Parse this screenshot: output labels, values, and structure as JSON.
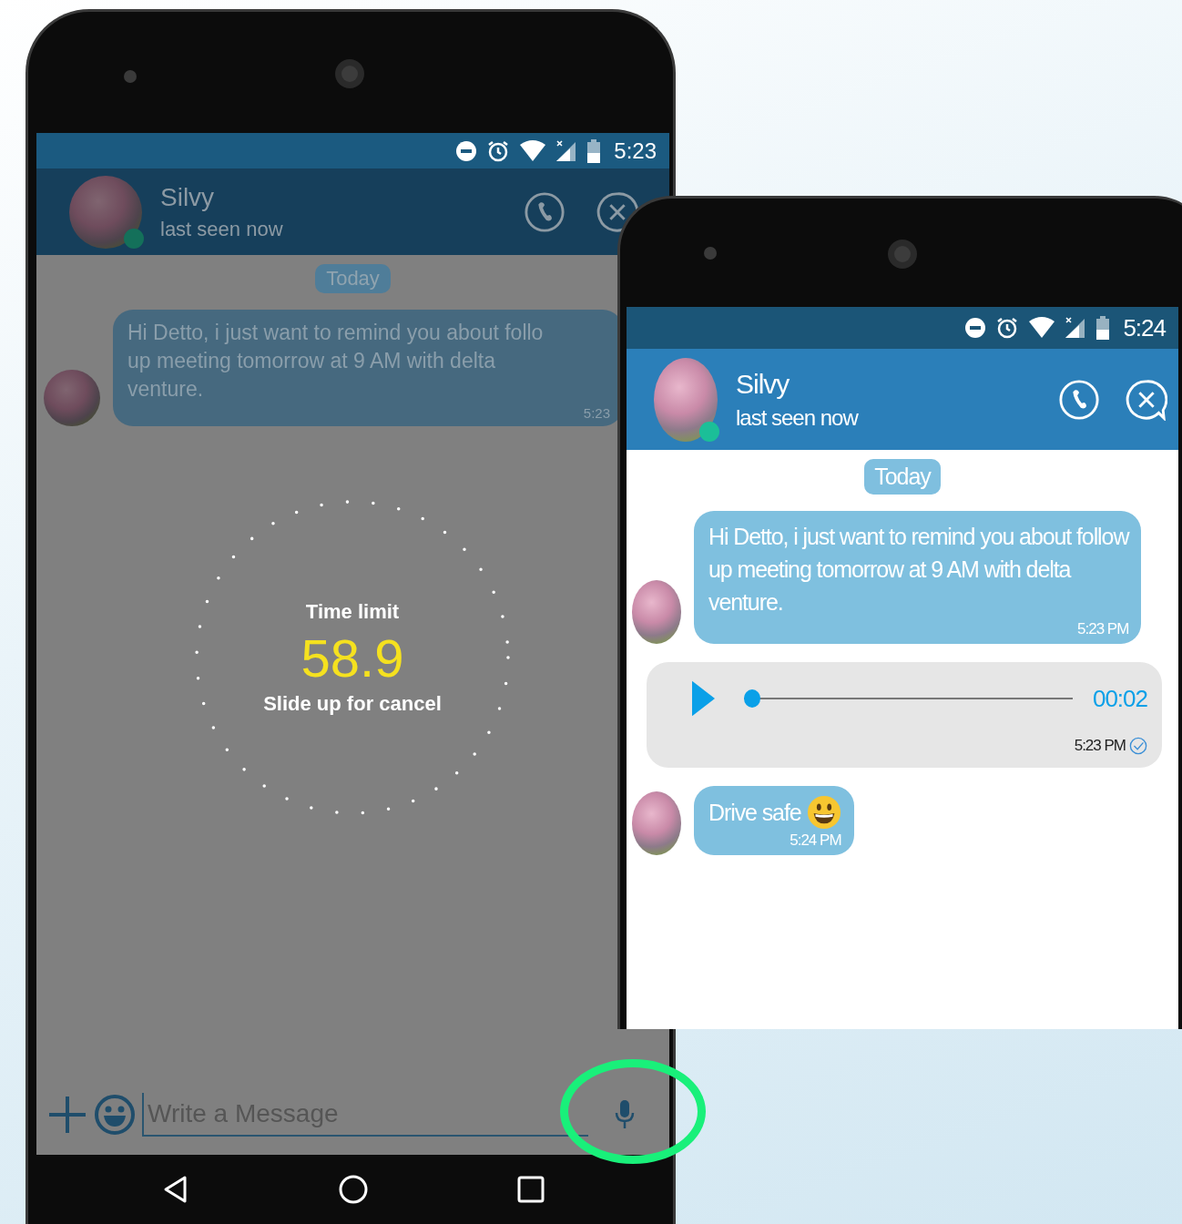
{
  "phones": [
    {
      "status_bar": {
        "time": "5:23"
      },
      "contact": {
        "name": "Silvy",
        "status": "last seen now",
        "online": true
      },
      "date_chip": "Today",
      "messages": [
        {
          "kind": "text",
          "text": "Hi Detto, i just want to remind you about follo\nup meeting tomorrow at 9 AM with delta\nventure.",
          "time": "5:23",
          "smiley": false
        }
      ],
      "recording": {
        "label": "Time limit",
        "countdown": "58.9",
        "hint": "Slide up for cancel"
      },
      "composer": {
        "placeholder": "Write a Message"
      }
    },
    {
      "status_bar": {
        "time": "5:24"
      },
      "contact": {
        "name": "Silvy",
        "status": "last seen now",
        "online": true
      },
      "date_chip": "Today",
      "messages": [
        {
          "kind": "text",
          "text": "Hi Detto, i just want to remind you about follow\nup meeting tomorrow at 9 AM with delta\nventure.",
          "time": "5:23 PM",
          "smiley": false
        },
        {
          "kind": "voice",
          "duration": "00:02",
          "time": "5:23 PM",
          "level": 0,
          "delivered": true
        },
        {
          "kind": "text",
          "text": "Drive safe",
          "time": "5:24 PM",
          "smiley": true
        }
      ]
    }
  ]
}
